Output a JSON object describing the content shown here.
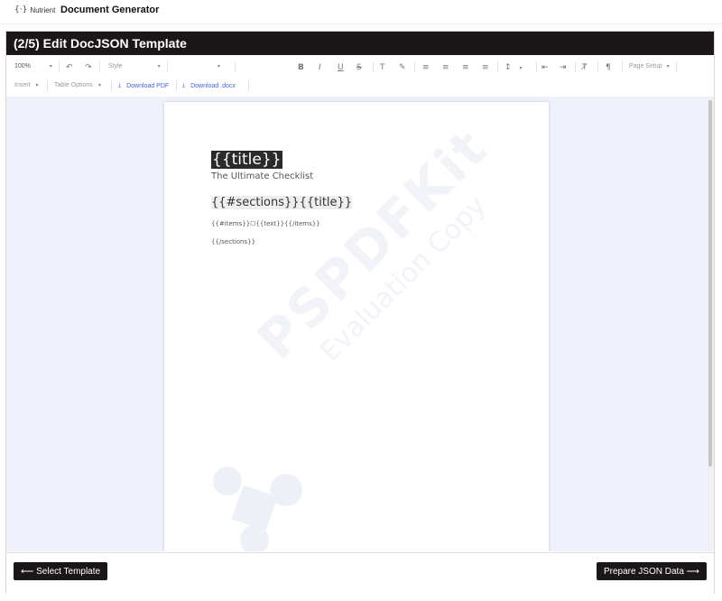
{
  "topbar": {
    "brand": "Nutrient",
    "brand_logo": "{·}",
    "app_title": "Document Generator"
  },
  "panel": {
    "title": "(2/5) Edit DocJSON Template"
  },
  "toolbar": {
    "zoom": "100%",
    "style_placeholder": "Style",
    "page_setup": "Page Setup",
    "insert": "Insert",
    "table_options": "Table Options",
    "download_pdf": "Download PDF",
    "download_docx": "Download .docx"
  },
  "icons": {
    "undo": "↶",
    "redo": "↷",
    "bold": "B",
    "italic": "I",
    "underline": "U",
    "strike": "S",
    "text_color": "T",
    "highlight": "✎",
    "align_left": "≡",
    "align_center": "≡",
    "align_right": "≡",
    "justify": "≡",
    "line_spacing": "↕",
    "outdent": "⇤",
    "indent": "⇥",
    "clear_format": "T̸",
    "pilcrow": "¶",
    "download": "⤓",
    "caret": "▾"
  },
  "document": {
    "title_tag": "{{title}}",
    "subtitle": "The Ultimate Checklist",
    "sections_tag": "{{#sections}}{{title}}",
    "items_tag": "{{#items}}☐{{text}}{{/items}}",
    "end_tag": "{{/sections}}",
    "watermark_line1": "PSPDFKit",
    "watermark_line2": "Evaluation Copy"
  },
  "footer": {
    "back_button": "⟵ Select Template",
    "next_button": "Prepare JSON Data ⟶"
  }
}
